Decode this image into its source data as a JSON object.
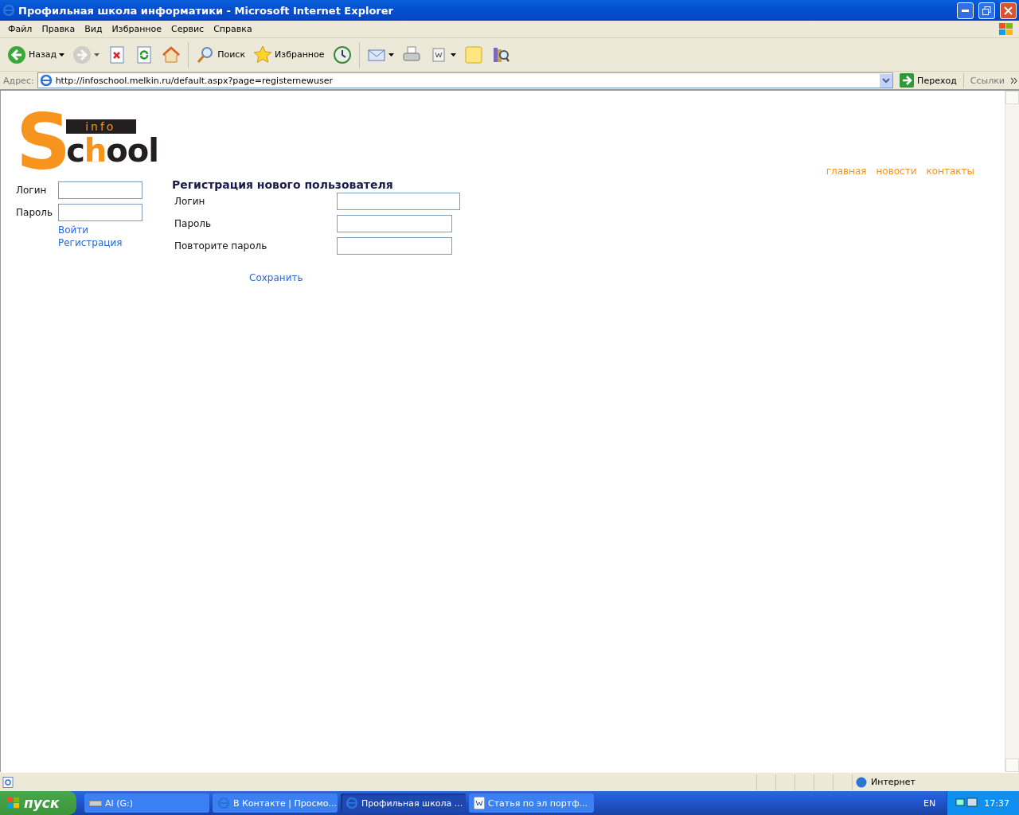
{
  "window": {
    "title": "Профильная школа информатики - Microsoft Internet Explorer"
  },
  "menu": [
    "Файл",
    "Правка",
    "Вид",
    "Избранное",
    "Сервис",
    "Справка"
  ],
  "toolbar": [
    {
      "kind": "back",
      "label": "Назад",
      "dropdown": true,
      "disabled": false
    },
    {
      "kind": "forward",
      "dropdown": true,
      "disabled": true
    },
    {
      "kind": "stop",
      "disabled": false
    },
    {
      "kind": "refresh",
      "disabled": false
    },
    {
      "kind": "home",
      "disabled": false
    },
    {
      "kind": "separator"
    },
    {
      "kind": "search",
      "label": "Поиск",
      "disabled": false
    },
    {
      "kind": "favorites",
      "label": "Избранное",
      "disabled": false
    },
    {
      "kind": "history",
      "disabled": false
    },
    {
      "kind": "separator"
    },
    {
      "kind": "mail",
      "dropdown": true,
      "disabled": false
    },
    {
      "kind": "print",
      "disabled": false
    },
    {
      "kind": "word",
      "dropdown": true,
      "disabled": false
    },
    {
      "kind": "note",
      "disabled": false
    },
    {
      "kind": "research",
      "disabled": false
    }
  ],
  "address": {
    "label": "Адрес:",
    "url": "http://infoschool.melkin.ru/default.aspx?page=registernewuser",
    "go": "Переход",
    "links": "Ссылки"
  },
  "page": {
    "logo": {
      "small": "info",
      "parts": [
        {
          "text": "S",
          "color": "#f7941d"
        },
        {
          "text": "c",
          "color": "#231f20"
        },
        {
          "text": "h",
          "color": "#f7941d"
        },
        {
          "text": "ool",
          "color": "#231f20"
        }
      ]
    },
    "nav": [
      "главная",
      "новости",
      "контакты"
    ],
    "login": {
      "fields": [
        {
          "label": "Логин"
        },
        {
          "label": "Пароль"
        }
      ],
      "links": [
        "Войти",
        "Регистрация"
      ]
    },
    "register": {
      "title": "Регистрация нового пользователя",
      "fields": [
        {
          "label": "Логин"
        },
        {
          "label": "Пароль"
        },
        {
          "label": "Повторите пароль"
        }
      ],
      "submit": "Сохранить"
    }
  },
  "status_bar": {
    "zone": "Интернет"
  },
  "taskbar": {
    "start": "пуск",
    "tasks": [
      {
        "label": "AI (G:)",
        "kind": "drive",
        "selected": false
      },
      {
        "label": "В Контакте | Просмо...",
        "kind": "ie",
        "selected": false
      },
      {
        "label": "Профильная школа ...",
        "kind": "ie",
        "selected": true
      },
      {
        "label": "Статья по эл портф...",
        "kind": "word",
        "selected": false
      }
    ],
    "language": "EN",
    "clock": "17:37"
  }
}
